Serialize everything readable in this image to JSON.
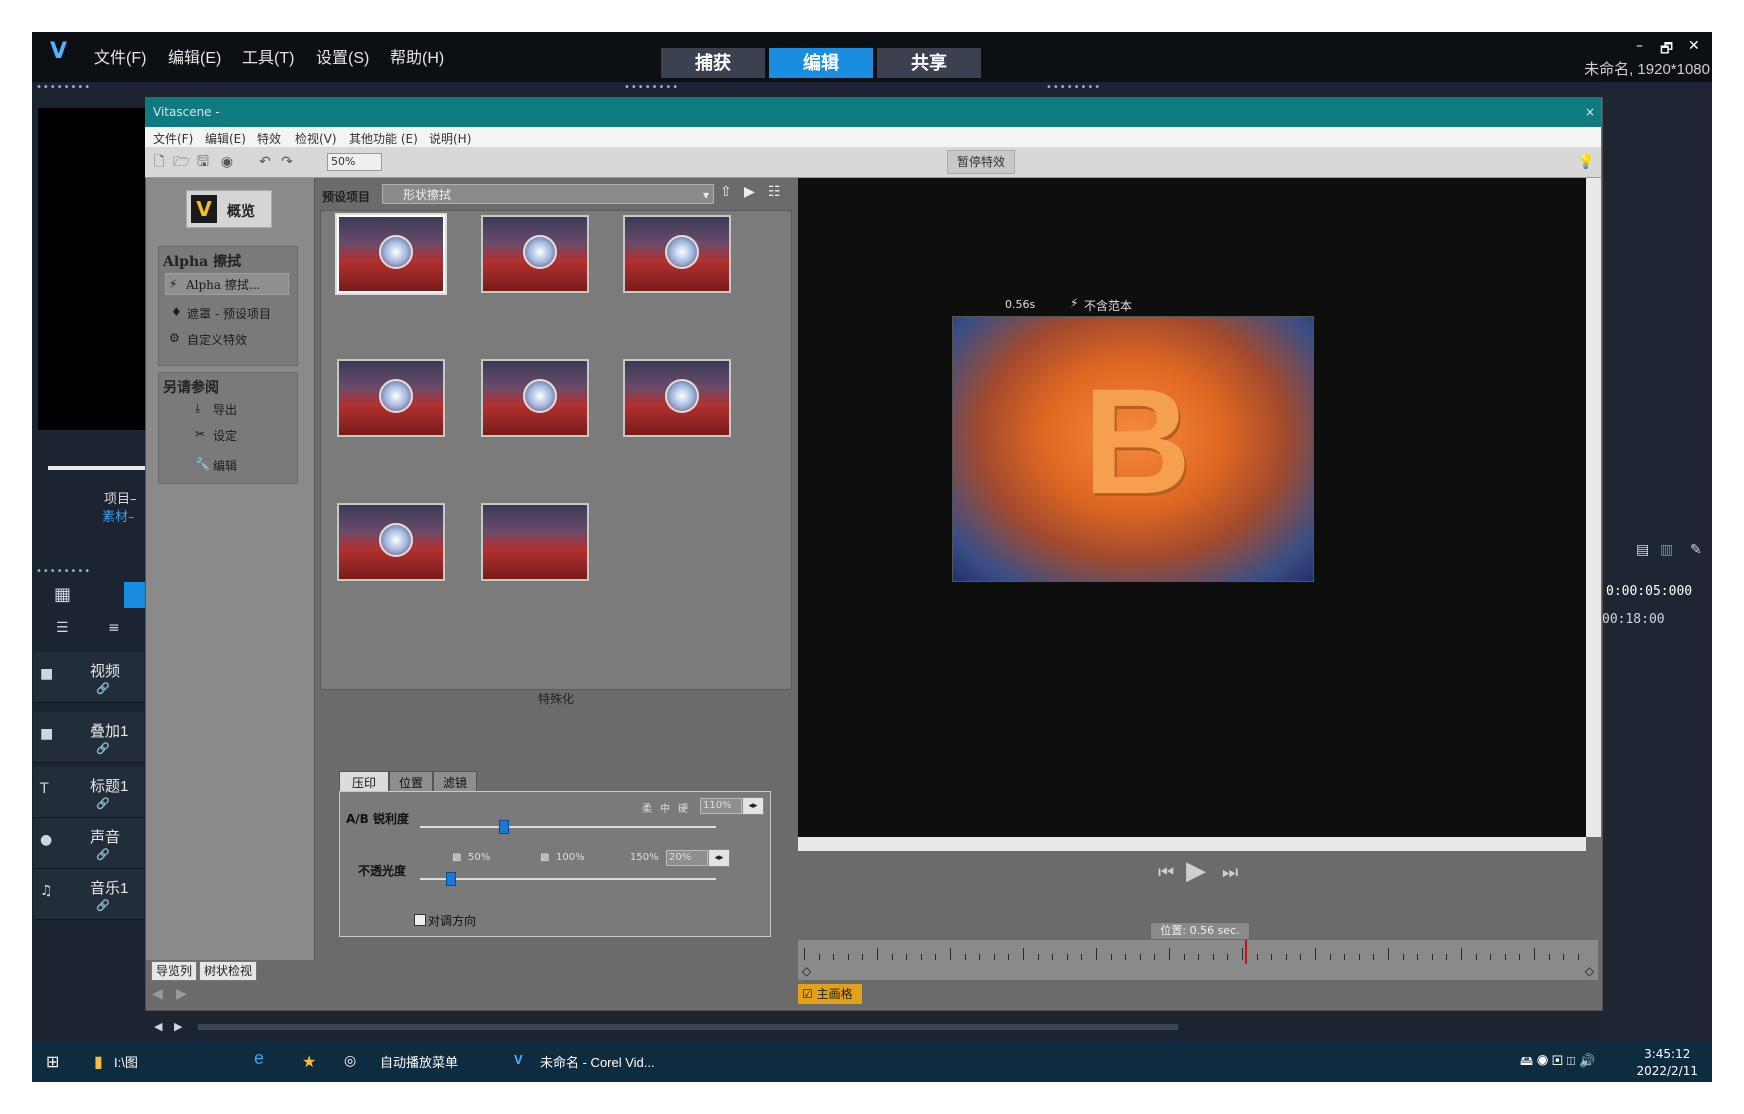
{
  "app": {
    "project_info": "未命名, 1920*1080",
    "menu": [
      "文件(F)",
      "编辑(E)",
      "工具(T)",
      "设置(S)",
      "帮助(H)"
    ],
    "modes": [
      "捕获",
      "编辑",
      "共享"
    ],
    "window_controls": [
      "–",
      "🗗",
      "✕"
    ]
  },
  "library": {
    "project_label": "项目–",
    "clip_label": "素材–",
    "timecode": "0:00:05:000",
    "timecode2": "00:18:00"
  },
  "tracks": [
    {
      "label": "视频",
      "icon": "video-icon"
    },
    {
      "label": "叠加1",
      "icon": "overlay-icon"
    },
    {
      "label": "标题1",
      "icon": "title-icon"
    },
    {
      "label": "声音",
      "icon": "voice-icon"
    },
    {
      "label": "音乐1",
      "icon": "music-icon"
    }
  ],
  "dialog": {
    "title": "Vitascene -",
    "menu": [
      "文件(F)",
      "编辑(E)",
      "特效",
      "检视(V)",
      "其他功能 (E)",
      "说明(H)"
    ],
    "zoom": "50%",
    "pause_button": "暂停特效",
    "overview_button": "概览",
    "group1": {
      "title": "Alpha 擦拭",
      "items": [
        "Alpha 擦拭...",
        "遮罩 - 预设项目",
        "自定义特效"
      ]
    },
    "group2": {
      "title": "另请参阅",
      "items": [
        "导出",
        "设定",
        "编辑"
      ]
    },
    "preset_label": "预设项目",
    "preset_value": "形状擦拭",
    "special_label": "特殊化",
    "param_tabs": [
      "压印",
      "位置",
      "滤镜"
    ],
    "sharpness": {
      "label": "A/B 锐利度",
      "scale_labels": [
        "柔",
        "中",
        "硬"
      ],
      "value": "110%",
      "level": 0.28
    },
    "opacity": {
      "label": "不透光度",
      "scale_labels": [
        "50%",
        "100%",
        "150%"
      ],
      "value": "20%",
      "level": 0.1
    },
    "reverse_label": "对调方向",
    "preview_time": "0.56s",
    "preview_tag": "不含范本",
    "position_label": "位置: 0.56 sec.",
    "mainframe_label": "主画格",
    "bottom_tabs": [
      "导览列",
      "树状检视"
    ]
  },
  "taskbar": {
    "items": [
      "I:\\图",
      "自动播放菜单",
      "未命名 - Corel Vid..."
    ],
    "time": "3:45:12",
    "date": "2022/2/11"
  },
  "colors": {
    "accent": "#1b8de0",
    "dialog_title": "#0f7a80",
    "mainframe": "#e3a118",
    "playhead": "#d01010"
  }
}
